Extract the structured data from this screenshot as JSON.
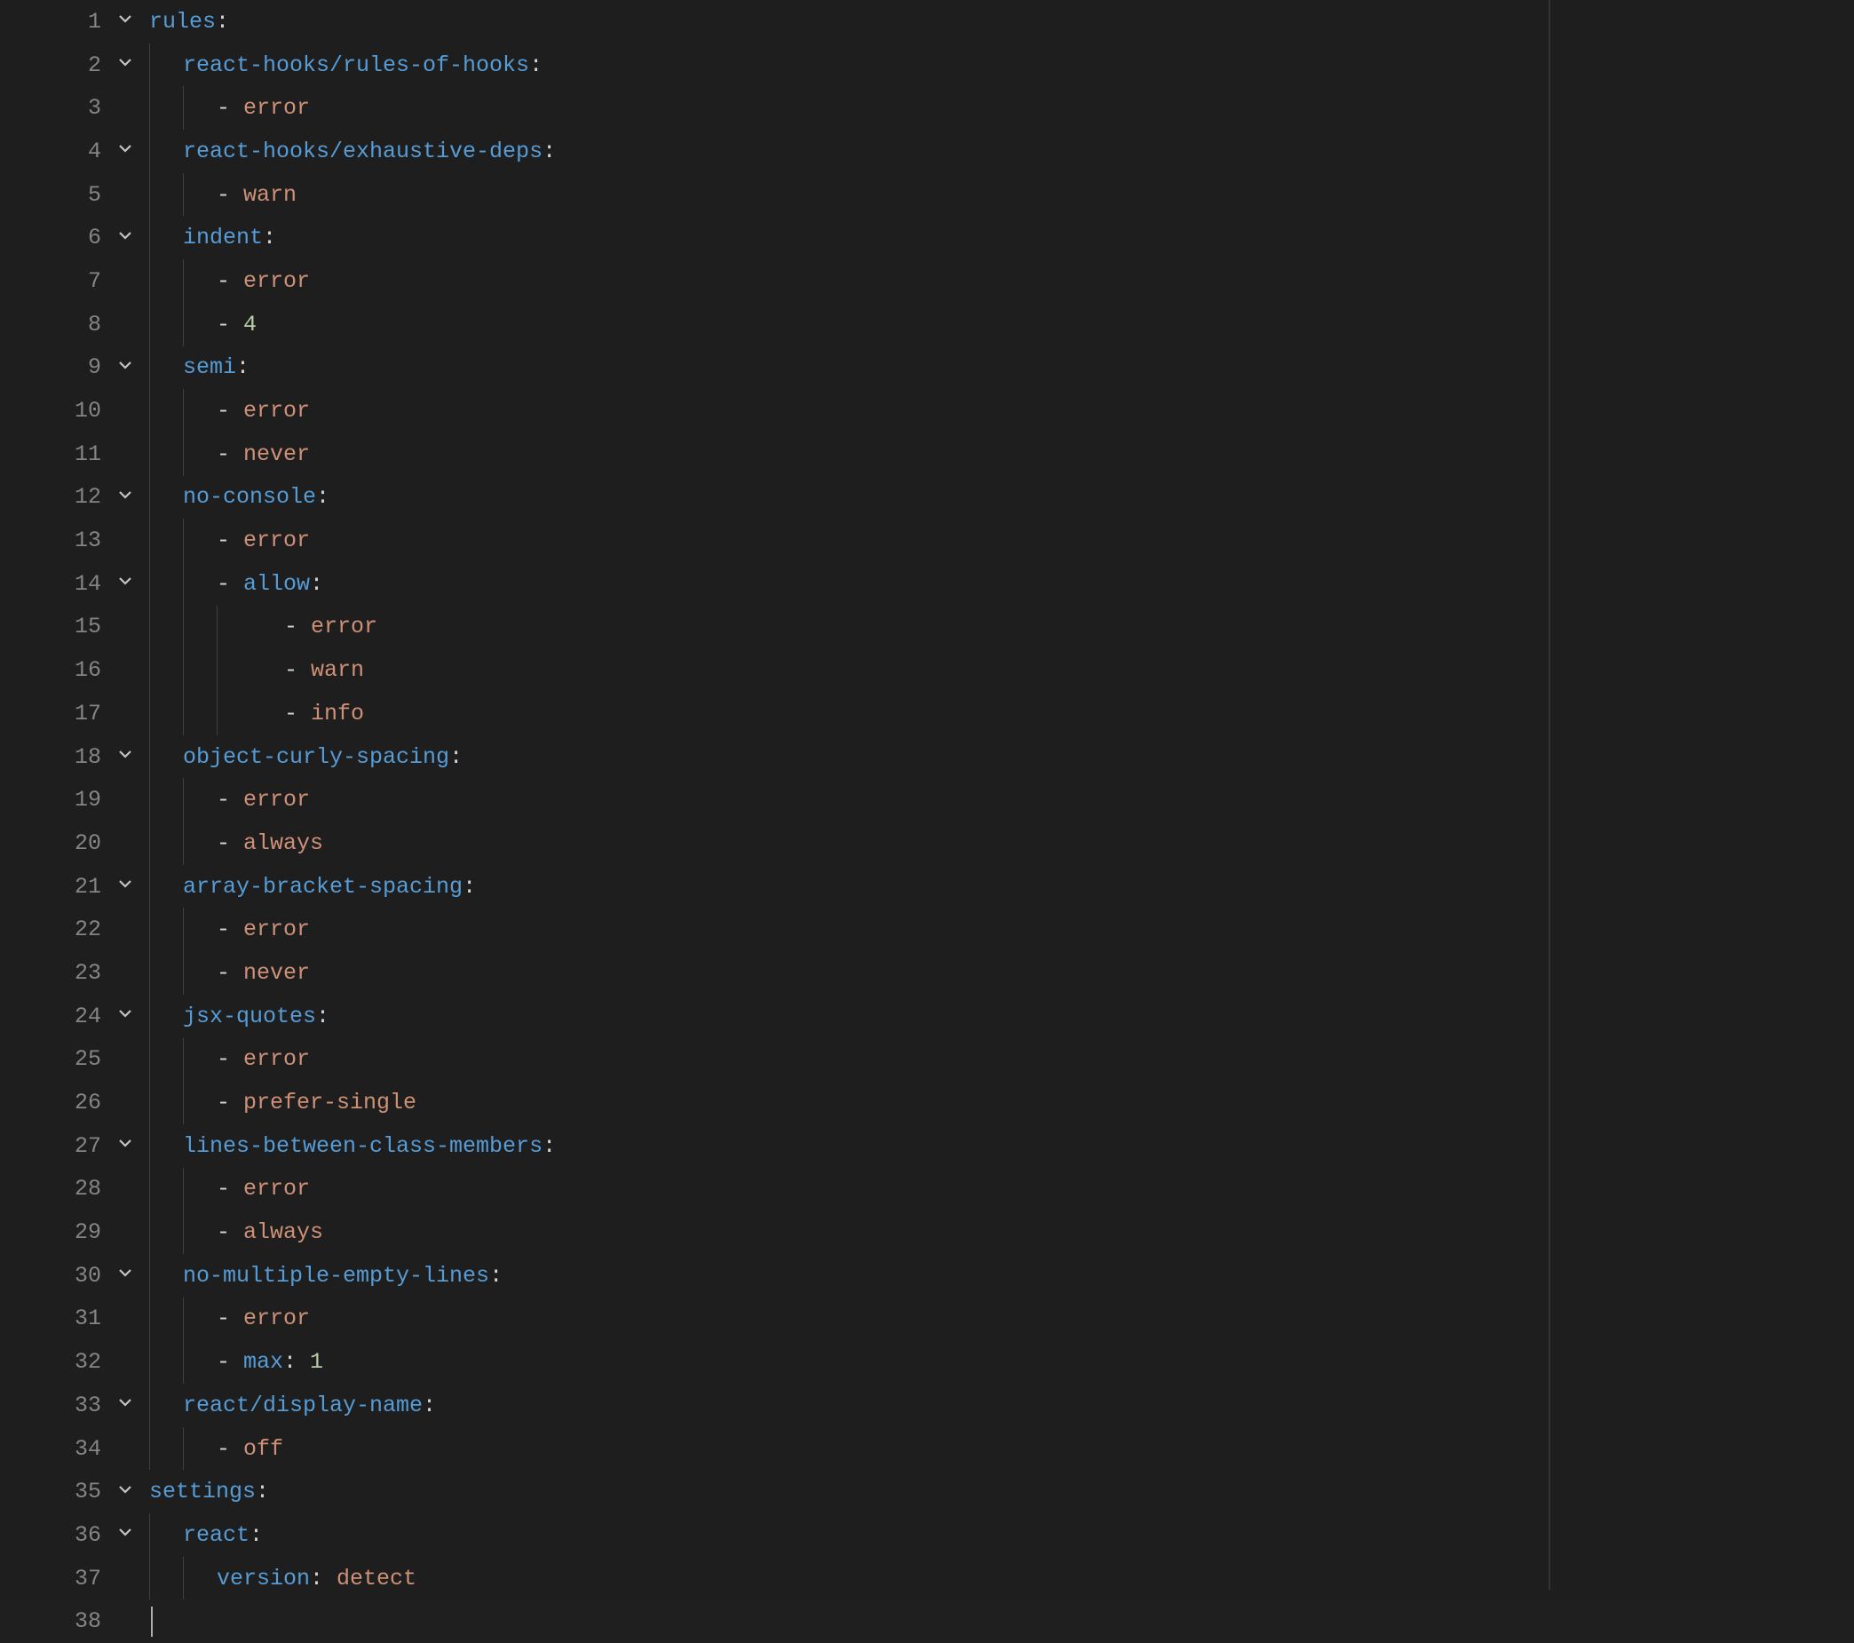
{
  "ruler_column": 80,
  "current_line": 38,
  "lines": [
    {
      "n": 1,
      "fold": true,
      "indent": 0,
      "tokens": [
        {
          "t": "key",
          "v": "rules"
        },
        {
          "t": "colon",
          "v": ":"
        }
      ]
    },
    {
      "n": 2,
      "fold": true,
      "indent": 1,
      "tokens": [
        {
          "t": "key",
          "v": "react-hooks/rules-of-hooks"
        },
        {
          "t": "colon",
          "v": ":"
        }
      ]
    },
    {
      "n": 3,
      "fold": false,
      "indent": 2,
      "tokens": [
        {
          "t": "dash",
          "v": "- "
        },
        {
          "t": "str",
          "v": "error"
        }
      ]
    },
    {
      "n": 4,
      "fold": true,
      "indent": 1,
      "tokens": [
        {
          "t": "key",
          "v": "react-hooks/exhaustive-deps"
        },
        {
          "t": "colon",
          "v": ":"
        }
      ]
    },
    {
      "n": 5,
      "fold": false,
      "indent": 2,
      "tokens": [
        {
          "t": "dash",
          "v": "- "
        },
        {
          "t": "str",
          "v": "warn"
        }
      ]
    },
    {
      "n": 6,
      "fold": true,
      "indent": 1,
      "tokens": [
        {
          "t": "key",
          "v": "indent"
        },
        {
          "t": "colon",
          "v": ":"
        }
      ]
    },
    {
      "n": 7,
      "fold": false,
      "indent": 2,
      "tokens": [
        {
          "t": "dash",
          "v": "- "
        },
        {
          "t": "str",
          "v": "error"
        }
      ]
    },
    {
      "n": 8,
      "fold": false,
      "indent": 2,
      "tokens": [
        {
          "t": "dash",
          "v": "- "
        },
        {
          "t": "num",
          "v": "4"
        }
      ]
    },
    {
      "n": 9,
      "fold": true,
      "indent": 1,
      "tokens": [
        {
          "t": "key",
          "v": "semi"
        },
        {
          "t": "colon",
          "v": ":"
        }
      ]
    },
    {
      "n": 10,
      "fold": false,
      "indent": 2,
      "tokens": [
        {
          "t": "dash",
          "v": "- "
        },
        {
          "t": "str",
          "v": "error"
        }
      ]
    },
    {
      "n": 11,
      "fold": false,
      "indent": 2,
      "tokens": [
        {
          "t": "dash",
          "v": "- "
        },
        {
          "t": "str",
          "v": "never"
        }
      ]
    },
    {
      "n": 12,
      "fold": true,
      "indent": 1,
      "tokens": [
        {
          "t": "key",
          "v": "no-console"
        },
        {
          "t": "colon",
          "v": ":"
        }
      ]
    },
    {
      "n": 13,
      "fold": false,
      "indent": 2,
      "tokens": [
        {
          "t": "dash",
          "v": "- "
        },
        {
          "t": "str",
          "v": "error"
        }
      ]
    },
    {
      "n": 14,
      "fold": true,
      "indent": 2,
      "tokens": [
        {
          "t": "dash",
          "v": "- "
        },
        {
          "t": "key",
          "v": "allow"
        },
        {
          "t": "colon",
          "v": ":"
        }
      ]
    },
    {
      "n": 15,
      "fold": false,
      "indent": 3,
      "tokens": [
        {
          "t": "dash",
          "v": "- "
        },
        {
          "t": "str",
          "v": "error"
        }
      ]
    },
    {
      "n": 16,
      "fold": false,
      "indent": 3,
      "tokens": [
        {
          "t": "dash",
          "v": "- "
        },
        {
          "t": "str",
          "v": "warn"
        }
      ]
    },
    {
      "n": 17,
      "fold": false,
      "indent": 3,
      "tokens": [
        {
          "t": "dash",
          "v": "- "
        },
        {
          "t": "str",
          "v": "info"
        }
      ]
    },
    {
      "n": 18,
      "fold": true,
      "indent": 1,
      "tokens": [
        {
          "t": "key",
          "v": "object-curly-spacing"
        },
        {
          "t": "colon",
          "v": ":"
        }
      ]
    },
    {
      "n": 19,
      "fold": false,
      "indent": 2,
      "tokens": [
        {
          "t": "dash",
          "v": "- "
        },
        {
          "t": "str",
          "v": "error"
        }
      ]
    },
    {
      "n": 20,
      "fold": false,
      "indent": 2,
      "tokens": [
        {
          "t": "dash",
          "v": "- "
        },
        {
          "t": "str",
          "v": "always"
        }
      ]
    },
    {
      "n": 21,
      "fold": true,
      "indent": 1,
      "tokens": [
        {
          "t": "key",
          "v": "array-bracket-spacing"
        },
        {
          "t": "colon",
          "v": ":"
        }
      ]
    },
    {
      "n": 22,
      "fold": false,
      "indent": 2,
      "tokens": [
        {
          "t": "dash",
          "v": "- "
        },
        {
          "t": "str",
          "v": "error"
        }
      ]
    },
    {
      "n": 23,
      "fold": false,
      "indent": 2,
      "tokens": [
        {
          "t": "dash",
          "v": "- "
        },
        {
          "t": "str",
          "v": "never"
        }
      ]
    },
    {
      "n": 24,
      "fold": true,
      "indent": 1,
      "tokens": [
        {
          "t": "key",
          "v": "jsx-quotes"
        },
        {
          "t": "colon",
          "v": ":"
        }
      ]
    },
    {
      "n": 25,
      "fold": false,
      "indent": 2,
      "tokens": [
        {
          "t": "dash",
          "v": "- "
        },
        {
          "t": "str",
          "v": "error"
        }
      ]
    },
    {
      "n": 26,
      "fold": false,
      "indent": 2,
      "tokens": [
        {
          "t": "dash",
          "v": "- "
        },
        {
          "t": "str",
          "v": "prefer-single"
        }
      ]
    },
    {
      "n": 27,
      "fold": true,
      "indent": 1,
      "tokens": [
        {
          "t": "key",
          "v": "lines-between-class-members"
        },
        {
          "t": "colon",
          "v": ":"
        }
      ]
    },
    {
      "n": 28,
      "fold": false,
      "indent": 2,
      "tokens": [
        {
          "t": "dash",
          "v": "- "
        },
        {
          "t": "str",
          "v": "error"
        }
      ]
    },
    {
      "n": 29,
      "fold": false,
      "indent": 2,
      "tokens": [
        {
          "t": "dash",
          "v": "- "
        },
        {
          "t": "str",
          "v": "always"
        }
      ]
    },
    {
      "n": 30,
      "fold": true,
      "indent": 1,
      "tokens": [
        {
          "t": "key",
          "v": "no-multiple-empty-lines"
        },
        {
          "t": "colon",
          "v": ":"
        }
      ]
    },
    {
      "n": 31,
      "fold": false,
      "indent": 2,
      "tokens": [
        {
          "t": "dash",
          "v": "- "
        },
        {
          "t": "str",
          "v": "error"
        }
      ]
    },
    {
      "n": 32,
      "fold": false,
      "indent": 2,
      "tokens": [
        {
          "t": "dash",
          "v": "- "
        },
        {
          "t": "key",
          "v": "max"
        },
        {
          "t": "colon",
          "v": ": "
        },
        {
          "t": "num",
          "v": "1"
        }
      ]
    },
    {
      "n": 33,
      "fold": true,
      "indent": 1,
      "tokens": [
        {
          "t": "key",
          "v": "react/display-name"
        },
        {
          "t": "colon",
          "v": ":"
        }
      ]
    },
    {
      "n": 34,
      "fold": false,
      "indent": 2,
      "tokens": [
        {
          "t": "dash",
          "v": "- "
        },
        {
          "t": "str",
          "v": "off"
        }
      ]
    },
    {
      "n": 35,
      "fold": true,
      "indent": 0,
      "tokens": [
        {
          "t": "key",
          "v": "settings"
        },
        {
          "t": "colon",
          "v": ":"
        }
      ]
    },
    {
      "n": 36,
      "fold": true,
      "indent": 1,
      "tokens": [
        {
          "t": "key",
          "v": "react"
        },
        {
          "t": "colon",
          "v": ":"
        }
      ]
    },
    {
      "n": 37,
      "fold": false,
      "indent": 2,
      "tokens": [
        {
          "t": "key",
          "v": "version"
        },
        {
          "t": "colon",
          "v": ": "
        },
        {
          "t": "str",
          "v": "detect"
        }
      ]
    },
    {
      "n": 38,
      "fold": false,
      "indent": 0,
      "tokens": [],
      "cursor": true
    }
  ]
}
